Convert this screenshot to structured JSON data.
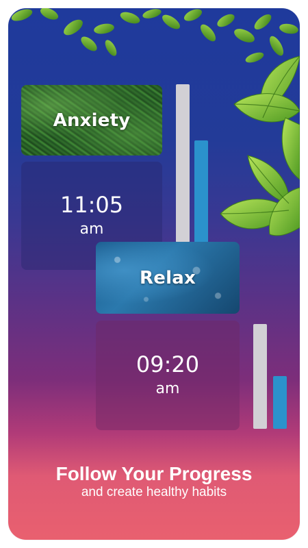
{
  "cards": [
    {
      "title": "Anxiety",
      "time": "11:05",
      "ampm": "am",
      "progress": {
        "total_fraction": 1.0,
        "done_fraction": 0.65
      }
    },
    {
      "title": "Relax",
      "time": "09:20",
      "ampm": "am",
      "progress": {
        "total_fraction": 1.0,
        "done_fraction": 0.5
      }
    }
  ],
  "footer": {
    "headline": "Follow Your Progress",
    "subheadline": "and create healthy habits"
  },
  "colors": {
    "gradient_top": "#1f3a9c",
    "gradient_bottom": "#e9606f",
    "bar_total": "#d2d0d5",
    "bar_progress": "#2b92cc"
  },
  "icons": [
    "leaves-decoration"
  ]
}
